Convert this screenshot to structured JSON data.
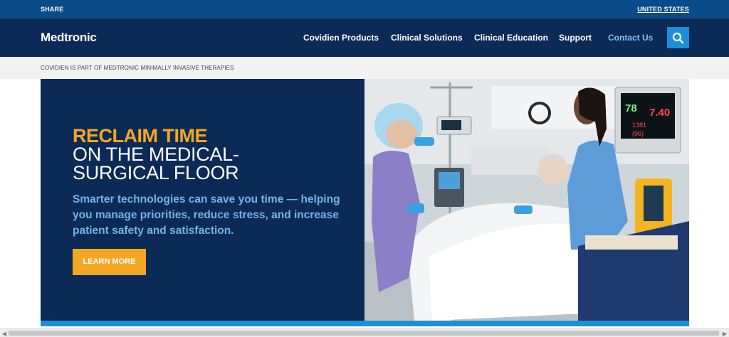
{
  "topbar": {
    "share": "SHARE",
    "country": "UNITED STATES"
  },
  "header": {
    "logo": "Medtronic",
    "nav": [
      "Covidien Products",
      "Clinical Solutions",
      "Clinical Education",
      "Support",
      "Contact Us"
    ],
    "search_icon": "search-icon"
  },
  "notice": "COVIDIEN IS PART OF MEDTRONIC MINIMALLY INVASIVE THERAPIES",
  "hero": {
    "headline_highlight": "RECLAIM TIME",
    "headline_line2": "ON THE MEDICAL-",
    "headline_line3": "SURGICAL FLOOR",
    "description": "Smarter technologies can save you time — helping you manage priorities, reduce stress, and increase patient safety and satisfaction.",
    "cta": "LEARN MORE",
    "monitor": {
      "value1": "78",
      "value2": "7.40",
      "value3": "1381",
      "value4": "(96)"
    }
  },
  "colors": {
    "top_bar": "#0a4b8c",
    "nav_bg": "#0b2a55",
    "accent_orange": "#f5a623",
    "accent_blue": "#1b8fd8",
    "link_blue": "#7cc4f0"
  }
}
